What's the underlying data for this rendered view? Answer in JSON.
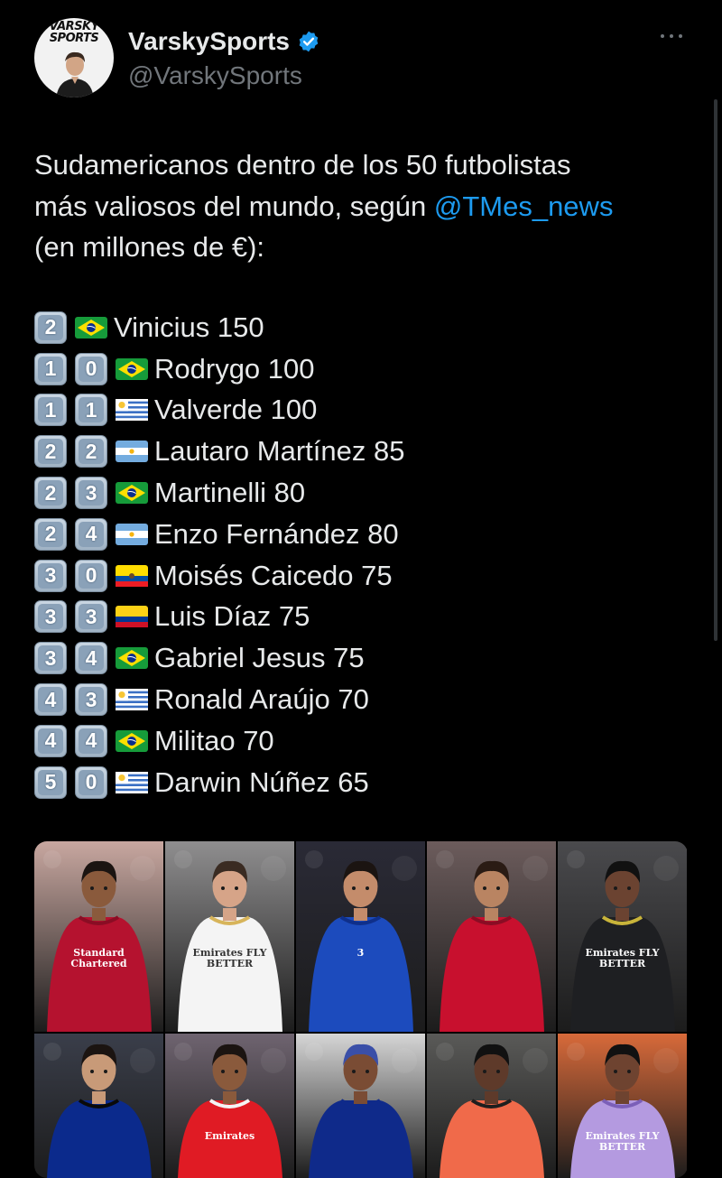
{
  "account": {
    "display_name": "VarskySports",
    "handle": "@VarskySports",
    "logo_text_1": "VARSKY",
    "logo_text_2": "SPORTS"
  },
  "tweet": {
    "line_1": "Sudamericanos dentro de los 50 futbolistas",
    "line_2_prefix": "más valiosos del mundo, según ",
    "mention": "@TMes_news",
    "line_3": "(en millones de €):"
  },
  "ranking": [
    {
      "digits": [
        "2"
      ],
      "flag": "brazil",
      "text": "Vinicius 150"
    },
    {
      "digits": [
        "1",
        "0"
      ],
      "flag": "brazil",
      "text": "Rodrygo 100"
    },
    {
      "digits": [
        "1",
        "1"
      ],
      "flag": "uruguay",
      "text": "Valverde 100"
    },
    {
      "digits": [
        "2",
        "2"
      ],
      "flag": "argentina",
      "text": "Lautaro Martínez 85"
    },
    {
      "digits": [
        "2",
        "3"
      ],
      "flag": "brazil",
      "text": "Martinelli 80"
    },
    {
      "digits": [
        "2",
        "4"
      ],
      "flag": "argentina",
      "text": "Enzo Fernández 80"
    },
    {
      "digits": [
        "3",
        "0"
      ],
      "flag": "ecuador",
      "text": "Moisés Caicedo 75"
    },
    {
      "digits": [
        "3",
        "3"
      ],
      "flag": "colombia",
      "text": "Luis Díaz 75"
    },
    {
      "digits": [
        "3",
        "4"
      ],
      "flag": "brazil",
      "text": "Gabriel Jesus 75"
    },
    {
      "digits": [
        "4",
        "3"
      ],
      "flag": "uruguay",
      "text": "Ronald Araújo 70"
    },
    {
      "digits": [
        "4",
        "4"
      ],
      "flag": "brazil",
      "text": "Militao 70"
    },
    {
      "digits": [
        "5",
        "0"
      ],
      "flag": "uruguay",
      "text": "Darwin Núñez 65"
    }
  ],
  "photos": [
    {
      "name": "photo-luis-diaz",
      "kit": "#b5122f",
      "trim": "#8a0d24",
      "bg": "#c8a7a0",
      "skin": "#8a5a3c",
      "hair": "#1b1411",
      "text": "Standard Chartered"
    },
    {
      "name": "photo-valverde",
      "kit": "#f4f4f4",
      "trim": "#d7b45a",
      "bg": "#8f8e8f",
      "skin": "#d6a488",
      "hair": "#3a2b22",
      "text": "Emirates FLY BETTER"
    },
    {
      "name": "photo-enzo-fernandez",
      "kit": "#1c4bbd",
      "trim": "#0f2f8a",
      "bg": "#2a2a36",
      "skin": "#c48c6b",
      "hair": "#1b1411",
      "text": "3"
    },
    {
      "name": "photo-darwin-nunez",
      "kit": "#c8102e",
      "trim": "#8a0d24",
      "bg": "#6c5c5c",
      "skin": "#b98462",
      "hair": "#2a1b14",
      "text": ""
    },
    {
      "name": "photo-vinicius",
      "kit": "#1e1f22",
      "trim": "#c9b43a",
      "bg": "#4a4a4d",
      "skin": "#6b4331",
      "hair": "#111",
      "text": "Emirates FLY BETTER"
    },
    {
      "name": "photo-lautaro",
      "kit": "#0b2a8c",
      "trim": "#0a0a0a",
      "bg": "#3a3e4a",
      "skin": "#c89a78",
      "hair": "#1b1411",
      "text": ""
    },
    {
      "name": "photo-gabriel-jesus",
      "kit": "#e01b24",
      "trim": "#f4f4f4",
      "bg": "#6f6470",
      "skin": "#8a5a3c",
      "hair": "#1b1411",
      "text": "Emirates"
    },
    {
      "name": "photo-caicedo",
      "kit": "#0f2a8a",
      "trim": "#0f2a8a",
      "bg": "#d6d6d6",
      "skin": "#7a4c34",
      "hair": "#3a4fa8",
      "text": ""
    },
    {
      "name": "photo-militao-caicedo-bhafc",
      "kit": "#f06a4a",
      "trim": "#1e1e1e",
      "bg": "#5a5a58",
      "skin": "#5e3a2a",
      "hair": "#111",
      "text": ""
    },
    {
      "name": "photo-rodrygo",
      "kit": "#b49ae0",
      "trim": "#7b5fb8",
      "bg": "#d86a3a",
      "skin": "#6e4330",
      "hair": "#111",
      "text": "Emirates FLY BETTER"
    }
  ],
  "colors": {
    "background": "#000000",
    "text": "#e7e9ea",
    "secondary": "#71767b",
    "link": "#1d9bf0",
    "verified": "#1d9bf0"
  }
}
